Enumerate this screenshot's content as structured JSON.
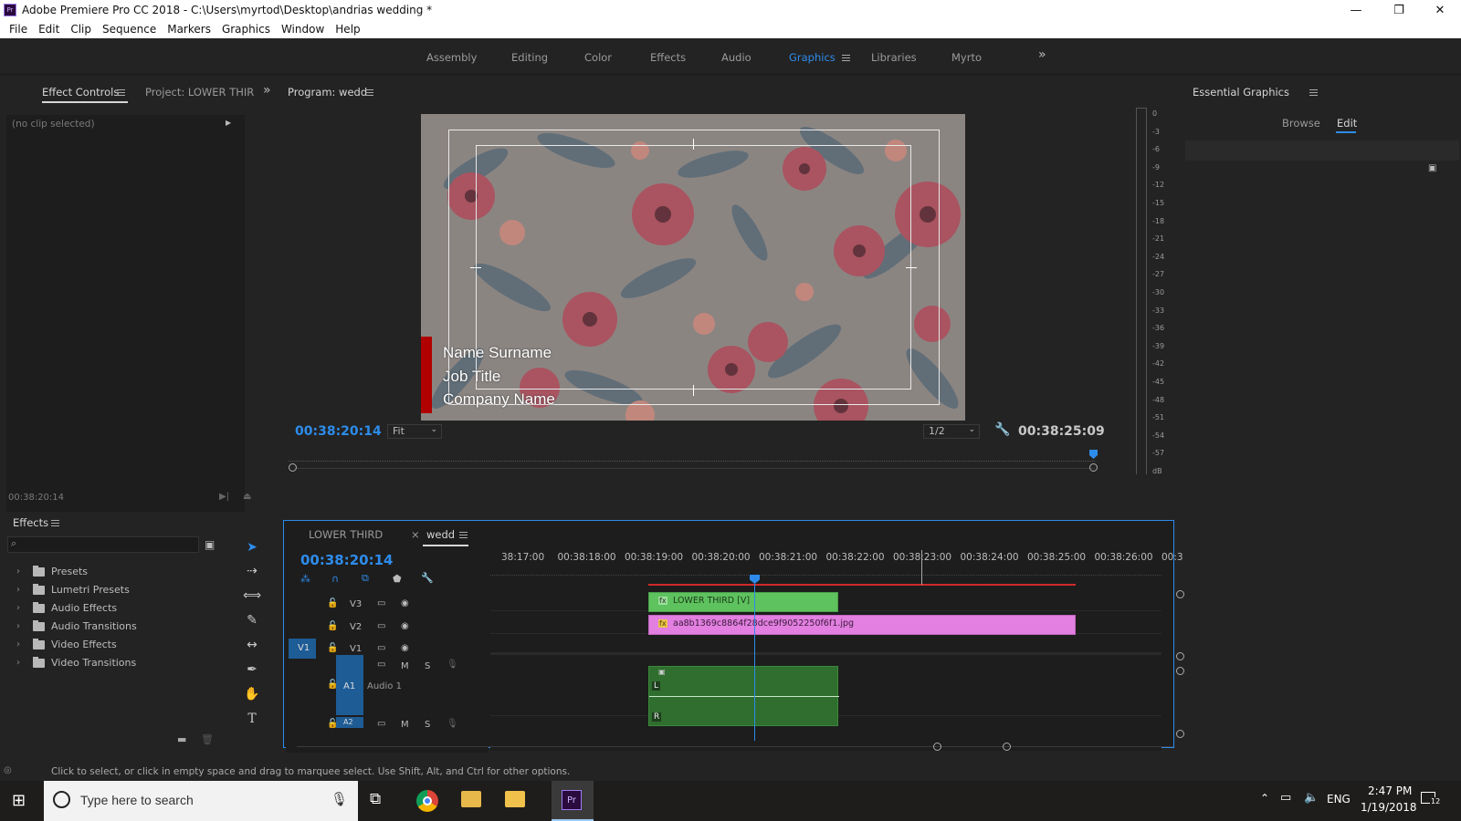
{
  "window": {
    "title": "Adobe Premiere Pro CC 2018 - C:\\Users\\myrtod\\Desktop\\andrias wedding *",
    "app_icon_label": "Pr",
    "minimize": "—",
    "restore": "❐",
    "close": "✕"
  },
  "menu": [
    "File",
    "Edit",
    "Clip",
    "Sequence",
    "Markers",
    "Graphics",
    "Window",
    "Help"
  ],
  "workspaces": {
    "items": [
      "Assembly",
      "Editing",
      "Color",
      "Effects",
      "Audio",
      "Graphics",
      "Libraries",
      "Myrto"
    ],
    "active": "Graphics",
    "overflow": "»"
  },
  "left_panel": {
    "tab_effect_controls": "Effect Controls",
    "tab_project": "Project: LOWER THIR",
    "overflow": "»",
    "no_clip": "(no clip selected)",
    "timecode": "00:38:20:14"
  },
  "program": {
    "title": "Program: wedd",
    "timecode_left": "00:38:20:14",
    "zoom": "Fit",
    "resolution": "1/2",
    "timecode_right": "00:38:25:09",
    "lower_third": [
      "Name Surname",
      "Job Title",
      "Company Name"
    ]
  },
  "audio_meter": {
    "labels": [
      "0",
      "-3",
      "-6",
      "-9",
      "-12",
      "-15",
      "-18",
      "-21",
      "-24",
      "-27",
      "-30",
      "-33",
      "-36",
      "-39",
      "-42",
      "-45",
      "-48",
      "-51",
      "-54",
      "-57",
      "dB"
    ]
  },
  "essential_graphics": {
    "title": "Essential Graphics",
    "tab_browse": "Browse",
    "tab_edit": "Edit"
  },
  "effects_panel": {
    "title": "Effects",
    "search_placeholder": "",
    "items": [
      "Presets",
      "Lumetri Presets",
      "Audio Effects",
      "Audio Transitions",
      "Video Effects",
      "Video Transitions"
    ]
  },
  "timeline": {
    "tab_lower_third": "LOWER THIRD",
    "tab_wedd": "wedd",
    "close_x": "×",
    "timecode": "00:38:20:14",
    "ruler": [
      "38:17:00",
      "00:38:18:00",
      "00:38:19:00",
      "00:38:20:00",
      "00:38:21:00",
      "00:38:22:00",
      "00:38:23:00",
      "00:38:24:00",
      "00:38:25:00",
      "00:38:26:00",
      "00:3"
    ],
    "tracks": {
      "v3": "V3",
      "v2": "V2",
      "v1": "V1",
      "v1_src": "V1",
      "a1": "A1",
      "a1_name": "Audio 1",
      "a2": "A2",
      "m": "M",
      "s": "S"
    },
    "clips": {
      "lower_third": "LOWER THIRD [V]",
      "image": "aa8b1369c8864f28dce9f9052250f6f1.jpg",
      "audio_l": "L",
      "audio_r": "R",
      "fx": "fx"
    }
  },
  "status_bar": {
    "text": "Click to select, or click in empty space and drag to marquee select. Use Shift, Alt, and Ctrl for other options."
  },
  "taskbar": {
    "search_placeholder": "Type here to search",
    "lang": "ENG",
    "time": "2:47 PM",
    "date": "1/19/2018",
    "notif_count": "12",
    "premiere_label": "Pr"
  },
  "colors": {
    "accent": "#2d8ceb",
    "clip_green": "#5ec25e",
    "clip_pink": "#e27fe0",
    "audio_green": "#2f6e2f",
    "red_bar": "#b10000"
  }
}
